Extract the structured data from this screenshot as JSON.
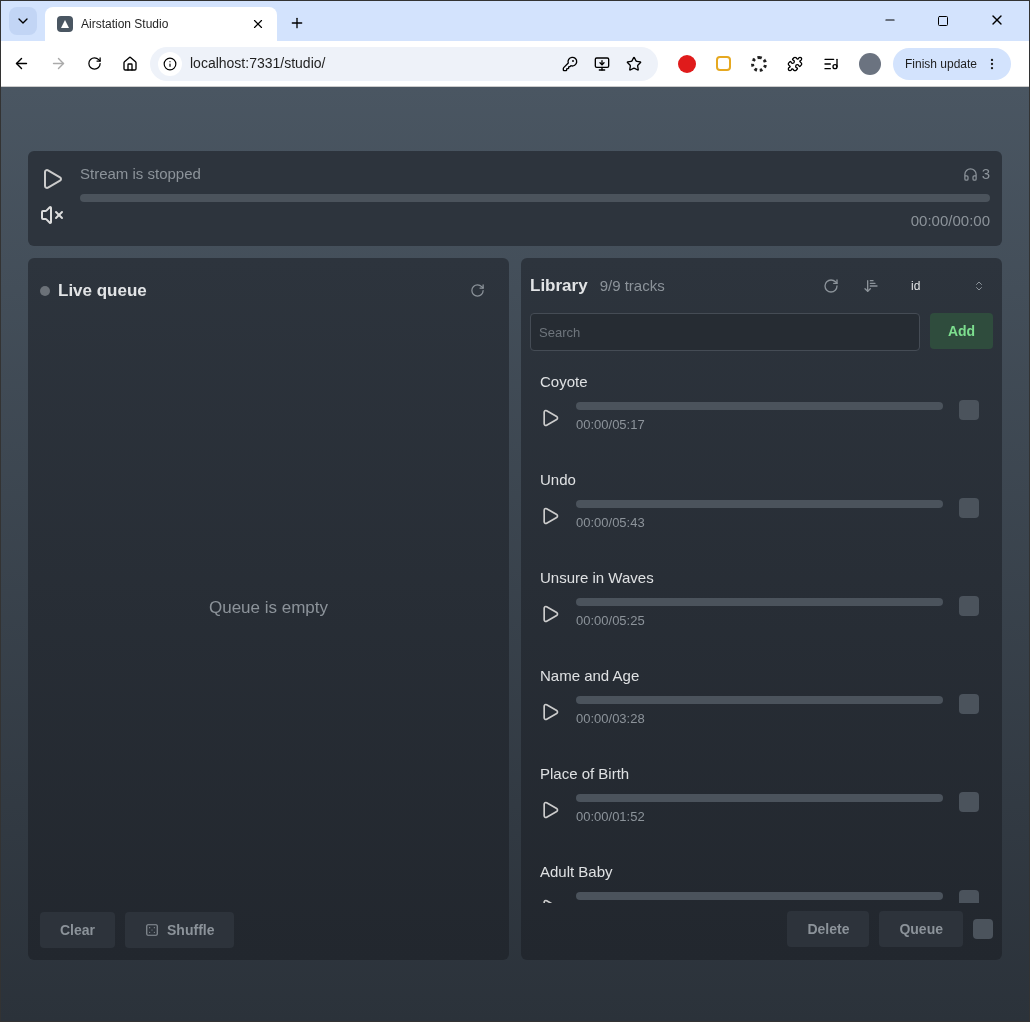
{
  "browser": {
    "tabs": [
      {
        "title": "Airstation Studio",
        "selected": true
      }
    ],
    "url": "localhost:7331/studio/",
    "update_button": "Finish update"
  },
  "player": {
    "status": "Stream is stopped",
    "listeners": "3",
    "time": "00:00/00:00",
    "muted": true
  },
  "queue": {
    "title": "Live queue",
    "empty_text": "Queue is empty",
    "buttons": [
      {
        "label": "Clear",
        "kind": "plain"
      },
      {
        "label": "Shuffle",
        "kind": "dice"
      }
    ]
  },
  "library": {
    "title": "Library",
    "count": "9/9 tracks",
    "sort": "id",
    "search": {
      "placeholder": "Search"
    },
    "add_button": "Add",
    "tracks": [
      {
        "title": "Coyote",
        "time": "00:00/05:17",
        "checked": false
      },
      {
        "title": "Undo",
        "time": "00:00/05:43",
        "checked": false
      },
      {
        "title": "Unsure in Waves",
        "time": "00:00/05:25",
        "checked": false
      },
      {
        "title": "Name and Age",
        "time": "00:00/03:28",
        "checked": false
      },
      {
        "title": "Place of Birth",
        "time": "00:00/01:52",
        "checked": false
      },
      {
        "title": "Adult Baby",
        "checked": false
      }
    ],
    "buttons": [
      "Delete",
      "Queue"
    ],
    "select_all": {
      "checked": false
    }
  }
}
